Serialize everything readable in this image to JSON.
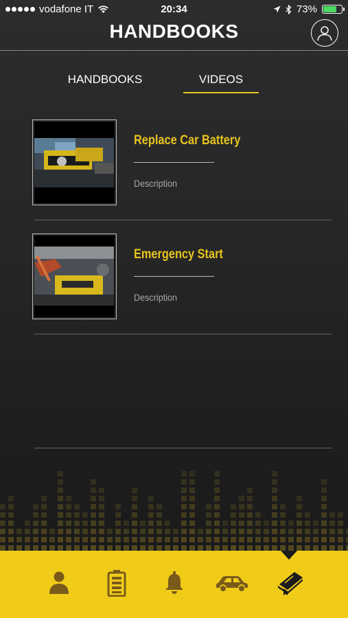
{
  "status_bar": {
    "carrier": "vodafone IT",
    "time": "20:34",
    "battery_percent": "73%",
    "battery_level": 0.73,
    "icons": [
      "signal-dots",
      "wifi-icon",
      "location-icon",
      "bluetooth-icon",
      "battery-icon"
    ]
  },
  "header": {
    "title": "HANDBOOKS",
    "profile_icon": "user-circle-icon"
  },
  "tabs": [
    {
      "label": "HANDBOOKS",
      "active": false
    },
    {
      "label": "VIDEOS",
      "active": true
    }
  ],
  "videos": [
    {
      "title": "Replace Car Battery",
      "description": "Description",
      "thumbnail": "car-battery-video-thumbnail"
    },
    {
      "title": "Emergency Start",
      "description": "Description",
      "thumbnail": "jump-start-video-thumbnail"
    }
  ],
  "bottom_nav": {
    "items": [
      {
        "icon": "person-icon",
        "active": false
      },
      {
        "icon": "battery-icon",
        "active": false
      },
      {
        "icon": "bell-icon",
        "active": false
      },
      {
        "icon": "car-icon",
        "active": false
      },
      {
        "icon": "handbook-icon",
        "active": true
      }
    ]
  },
  "colors": {
    "accent": "#f0cc19",
    "title_yellow": "#e8c41e",
    "nav_icon": "#7a5a1a",
    "background": "#262626"
  }
}
